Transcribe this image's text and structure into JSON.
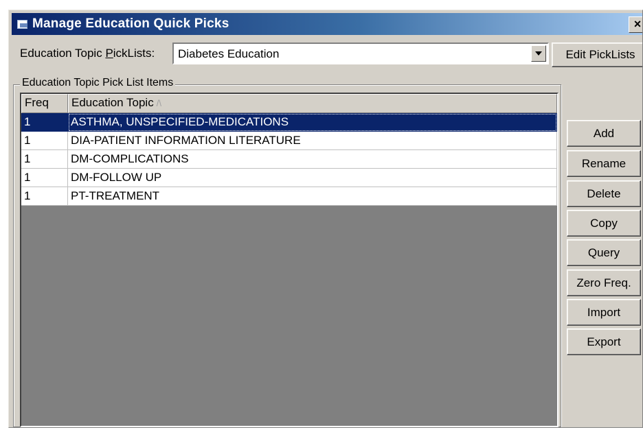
{
  "window": {
    "title": "Manage Education Quick Picks",
    "close_label": "×"
  },
  "picklist": {
    "label_before": "Education Topic ",
    "label_mnemonic": "P",
    "label_after": "ickLists:",
    "selected_value": "Diabetes Education",
    "edit_button_label": "Edit PickLists"
  },
  "group": {
    "legend": "Education Topic Pick List Items"
  },
  "grid": {
    "columns": [
      "Freq",
      "Education Topic"
    ],
    "sort_indicator": "/\\",
    "rows": [
      {
        "freq": "1",
        "topic": "ASTHMA, UNSPECIFIED-MEDICATIONS",
        "selected": true
      },
      {
        "freq": "1",
        "topic": "DIA-PATIENT INFORMATION LITERATURE",
        "selected": false
      },
      {
        "freq": "1",
        "topic": "DM-COMPLICATIONS",
        "selected": false
      },
      {
        "freq": "1",
        "topic": "DM-FOLLOW UP",
        "selected": false
      },
      {
        "freq": "1",
        "topic": "PT-TREATMENT",
        "selected": false
      }
    ]
  },
  "actions": {
    "add": "Add",
    "rename": "Rename",
    "delete": "Delete",
    "copy": "Copy",
    "query": "Query",
    "zero_freq": "Zero Freq.",
    "import": "Import",
    "export": "Export"
  },
  "colors": {
    "selection": "#0a246a",
    "face": "#d4d0c8",
    "grid_background": "#808080"
  }
}
